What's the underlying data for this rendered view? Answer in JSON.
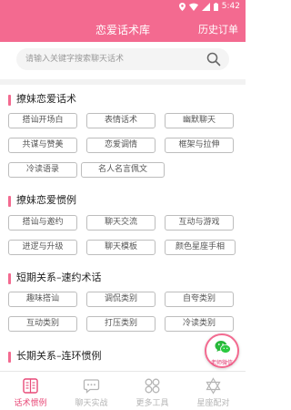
{
  "status_bar": {
    "time": "5:42"
  },
  "app_bar": {
    "title": "恋爱话术库",
    "action_label": "历史订单"
  },
  "search": {
    "placeholder": "请输入关键字搜索聊天话术",
    "value": ""
  },
  "sections": [
    {
      "title": "撩妹恋爱话术",
      "tags": [
        "搭讪开场白",
        "表情话术",
        "幽默聊天",
        "共谋与赞美",
        "恋爱调情",
        "框架与拉伸",
        "冷读语录",
        "名人名言佩文"
      ]
    },
    {
      "title": "撩妹恋爱惯例",
      "tags": [
        "搭讪与邀约",
        "聊天交流",
        "互动与游戏",
        "进逻与升级",
        "聊天模板",
        "颜色星座手相"
      ]
    },
    {
      "title": "短期关系–速约术话",
      "tags": [
        "趣味搭讪",
        "调侃类别",
        "自夸类别",
        "互动类别",
        "打压类别",
        "冷读类别"
      ]
    },
    {
      "title": "长期关系–连环惯例",
      "tags": []
    }
  ],
  "float_button": {
    "label": "老师微信",
    "icon": "wechat-icon"
  },
  "bottom_nav": [
    {
      "label": "话术惯例",
      "icon": "book-icon",
      "active": true
    },
    {
      "label": "聊天实战",
      "icon": "chat-icon",
      "active": false
    },
    {
      "label": "更多工具",
      "icon": "grid-icon",
      "active": false
    },
    {
      "label": "星座配对",
      "icon": "star-icon",
      "active": false
    }
  ],
  "colors": {
    "accent": "#f36a90",
    "active_nav": "#e84a78",
    "inactive_nav": "#b5b5b5"
  }
}
